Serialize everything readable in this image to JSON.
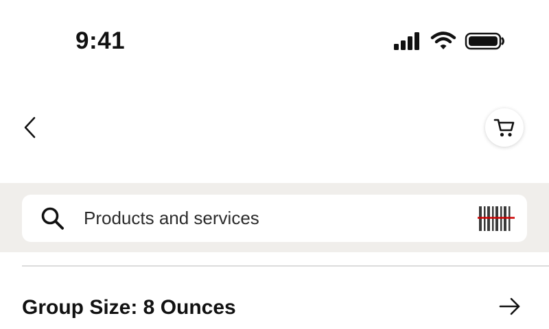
{
  "status_bar": {
    "time": "9:41",
    "icons": [
      "cellular-signal-icon",
      "wifi-icon",
      "battery-icon"
    ]
  },
  "nav": {
    "back_icon": "chevron-left-icon",
    "cart_icon": "shopping-cart-icon"
  },
  "search": {
    "placeholder": "Products and services",
    "search_icon": "magnifier-icon",
    "barcode_icon": "barcode-scanner-icon",
    "barcode_accent_color": "#cc0000"
  },
  "section": {
    "title": "Group Size: 8 Ounces",
    "arrow_icon": "arrow-right-icon"
  }
}
